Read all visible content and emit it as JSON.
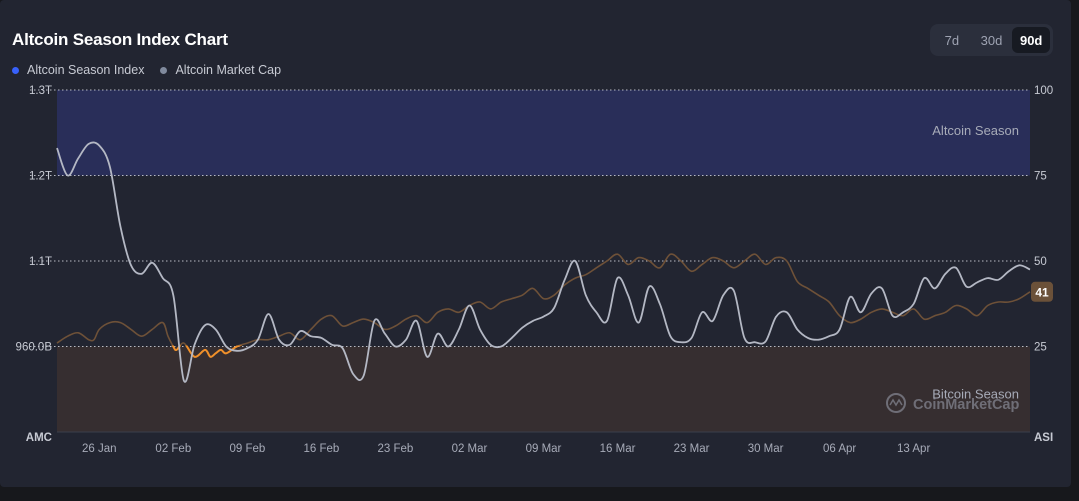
{
  "chart_data": {
    "type": "line",
    "title": "Altcoin Season Index Chart",
    "legend": [
      {
        "label": "Altcoin Season Index",
        "color": "#3861fb"
      },
      {
        "label": "Altcoin Market Cap",
        "color": "#808a9d"
      }
    ],
    "range_options": [
      {
        "label": "7d",
        "active": false
      },
      {
        "label": "30d",
        "active": false
      },
      {
        "label": "90d",
        "active": true
      }
    ],
    "x_ticks": [
      "26 Jan",
      "02 Feb",
      "09 Feb",
      "16 Feb",
      "23 Feb",
      "02 Mar",
      "09 Mar",
      "16 Mar",
      "23 Mar",
      "30 Mar",
      "06 Apr",
      "13 Apr"
    ],
    "x_range_days": [
      0,
      92
    ],
    "x_tick_days": [
      4,
      11,
      18,
      25,
      32,
      39,
      46,
      53,
      60,
      67,
      74,
      81
    ],
    "left_axis": {
      "label": "AMC",
      "ticks": [
        "1.3T",
        "1.2T",
        "1.1T",
        "960.0B"
      ],
      "tick_values": [
        1300,
        1200,
        1100,
        1000
      ],
      "range": [
        900,
        1300
      ]
    },
    "right_axis": {
      "label": "ASI",
      "ticks": [
        "100",
        "75",
        "50",
        "25"
      ],
      "tick_values": [
        100,
        75,
        50,
        25
      ],
      "range": [
        0,
        100
      ]
    },
    "zones": [
      {
        "label": "Altcoin Season",
        "from": 75,
        "to": 100,
        "color": "#2a3060"
      },
      {
        "label": "Bitcoin Season",
        "from": 0,
        "to": 25,
        "color": "#3a3030"
      }
    ],
    "grid": true,
    "current_asi": "41",
    "watermark": "CoinMarketCap",
    "series": [
      {
        "name": "Altcoin Season Index",
        "axis": "right",
        "x": [
          0,
          1,
          2,
          3,
          3.5,
          4,
          5,
          6,
          7,
          8,
          9,
          10,
          10.5,
          11,
          11.3,
          12,
          13,
          14,
          14.5,
          15,
          15.5,
          16,
          17,
          18,
          19,
          20,
          21,
          22,
          23,
          24,
          25,
          26,
          27,
          28,
          29,
          30,
          31,
          32,
          33,
          34,
          35,
          36,
          37,
          38,
          39,
          40,
          41,
          42,
          43,
          44,
          45,
          46,
          47,
          48,
          49,
          50,
          51,
          52,
          53,
          54,
          55,
          56,
          57,
          58,
          59,
          60,
          61,
          62,
          63,
          64,
          65,
          66,
          67,
          68,
          69,
          70,
          71,
          72,
          73,
          74,
          75,
          76,
          77,
          78,
          79,
          80,
          81,
          82,
          83,
          84,
          85,
          86,
          87,
          88,
          89,
          90,
          91,
          92
        ],
        "y": [
          26,
          28,
          29,
          27,
          27,
          30,
          32,
          32,
          30,
          28,
          30,
          32,
          28,
          25,
          24,
          26,
          22,
          24,
          22,
          23,
          24,
          23,
          25,
          26,
          27,
          27,
          28,
          29,
          27,
          30,
          33,
          34,
          31,
          32,
          33,
          32,
          30,
          31,
          33,
          34,
          32,
          35,
          36,
          35,
          37,
          38,
          36,
          38,
          39,
          40,
          42,
          39,
          40,
          43,
          45,
          46,
          48,
          50,
          52,
          49,
          51,
          50,
          48,
          52,
          50,
          47,
          49,
          51,
          50,
          48,
          50,
          52,
          49,
          51,
          50,
          44,
          42,
          40,
          38,
          34,
          32,
          33,
          35,
          36,
          35,
          34,
          36,
          33,
          34,
          35,
          37,
          36,
          34,
          37,
          38,
          38,
          39,
          41
        ]
      },
      {
        "name": "Altcoin Market Cap",
        "axis": "left",
        "x": [
          0,
          1,
          2,
          3,
          4,
          5,
          6,
          7,
          8,
          9,
          10,
          11,
          12,
          13,
          14,
          15,
          16,
          17,
          18,
          19,
          20,
          21,
          22,
          23,
          24,
          25,
          26,
          27,
          28,
          29,
          30,
          31,
          32,
          33,
          34,
          35,
          36,
          37,
          38,
          39,
          40,
          41,
          42,
          43,
          44,
          45,
          46,
          47,
          48,
          49,
          50,
          51,
          52,
          53,
          54,
          55,
          56,
          57,
          58,
          59,
          60,
          61,
          62,
          63,
          64,
          65,
          66,
          67,
          68,
          69,
          70,
          71,
          72,
          73,
          74,
          75,
          76,
          77,
          78,
          79,
          80,
          81,
          82,
          83,
          84,
          85,
          86,
          87,
          88,
          89,
          90,
          91,
          92
        ],
        "y": [
          1232,
          1200,
          1220,
          1237,
          1235,
          1210,
          1140,
          1095,
          1085,
          1098,
          1080,
          1060,
          960,
          1002,
          1025,
          1020,
          1000,
          995,
          998,
          1008,
          1038,
          1008,
          1002,
          1018,
          1012,
          1010,
          1002,
          998,
          968,
          966,
          1030,
          1015,
          1000,
          1008,
          1030,
          988,
          1015,
          1000,
          1020,
          1048,
          1020,
          1002,
          1000,
          1010,
          1022,
          1030,
          1035,
          1045,
          1078,
          1100,
          1060,
          1040,
          1030,
          1080,
          1060,
          1028,
          1070,
          1050,
          1012,
          1005,
          1010,
          1040,
          1030,
          1060,
          1065,
          1010,
          1005,
          1006,
          1035,
          1040,
          1020,
          1010,
          1008,
          1012,
          1020,
          1058,
          1040,
          1062,
          1068,
          1036,
          1040,
          1050,
          1080,
          1068,
          1085,
          1092,
          1070,
          1075,
          1080,
          1078,
          1088,
          1095,
          1090
        ]
      }
    ]
  }
}
